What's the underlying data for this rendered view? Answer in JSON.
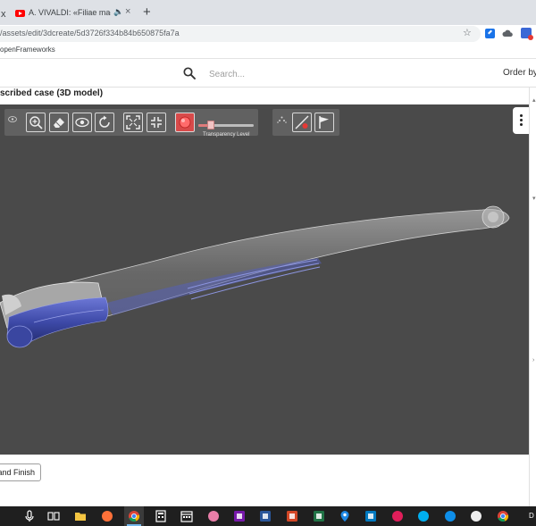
{
  "browser": {
    "prev_tab_fragment": "x",
    "active_tab": {
      "title": "A. VIVALDI: «Filiae maestae",
      "audio_icon": "speaker-icon",
      "close_glyph": "×"
    },
    "new_tab_glyph": "+",
    "url": "/assets/edit/3dcreate/5d3726f334b84b650875fa7a",
    "bookmarks": [
      "openFrameworks"
    ]
  },
  "app": {
    "search": {
      "placeholder": "Search..."
    },
    "order_by_label": "Order by",
    "page_title": "scribed case (3D model)"
  },
  "viewer": {
    "toolbar_left": [
      "zoom-icon",
      "eraser-icon",
      "eye-icon",
      "rotate-icon",
      "fullscreen-icon",
      "fit-icon",
      "color-picker-icon"
    ],
    "transparency": {
      "label": "Transparency Level",
      "value": 0.2
    },
    "toolbar_right": [
      "no-fill-icon",
      "flag-icon"
    ],
    "colors": {
      "background": "#4a4a4a",
      "toolbar": "#616161",
      "model_blue": "#3e4aa8",
      "model_ghost": "#b8b8b8"
    }
  },
  "footer": {
    "finish_label": "and Finish"
  },
  "taskbar": {
    "icons": [
      "mic-icon",
      "task-view-icon",
      "file-explorer-icon",
      "firefox-icon",
      "chrome-icon",
      "calculator-icon",
      "calendar-icon",
      "paint-icon",
      "onenote-icon",
      "word-icon",
      "powerpoint-icon",
      "excel-icon",
      "maps-icon",
      "trello-icon",
      "slack-icon",
      "skype-icon",
      "teamviewer-icon",
      "app-b-icon",
      "chrome-profile-icon"
    ],
    "clock_fragment": "D"
  }
}
